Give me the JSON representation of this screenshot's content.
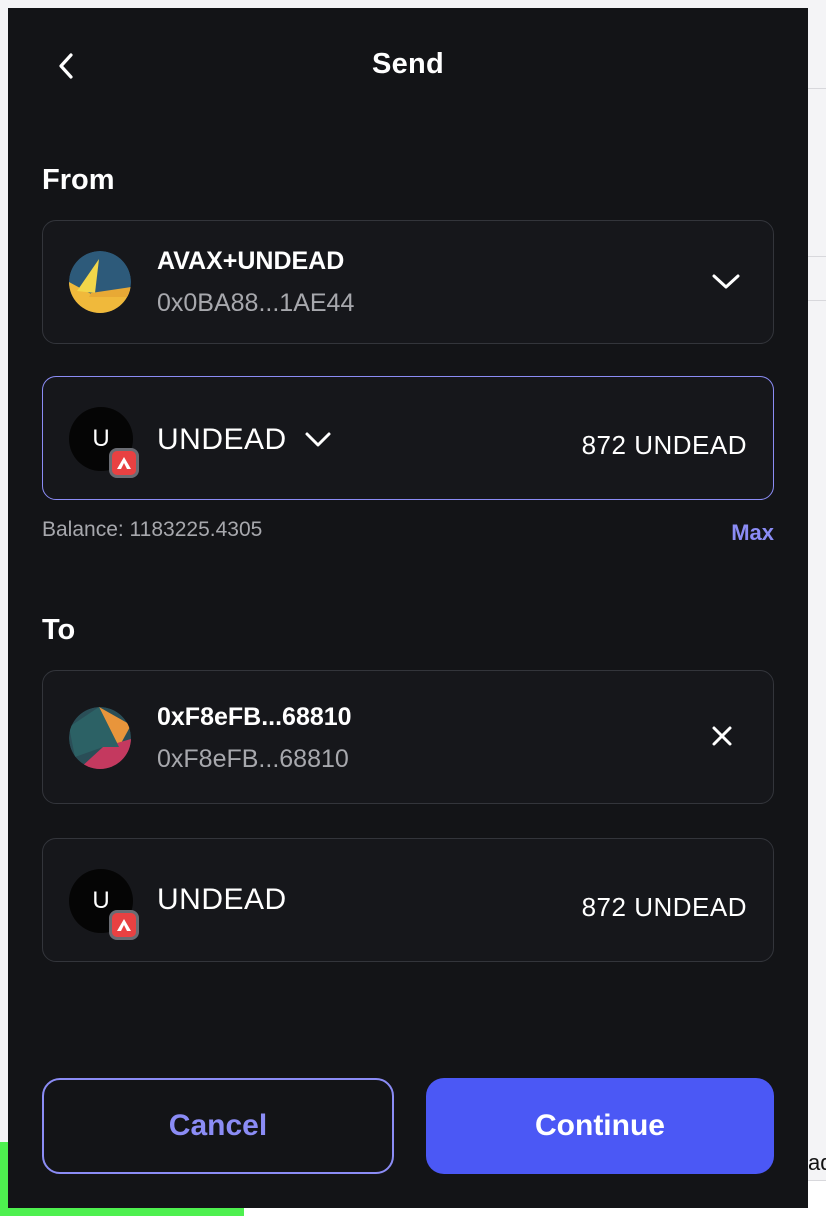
{
  "header": {
    "title": "Send"
  },
  "from": {
    "label": "From",
    "account": {
      "name": "AVAX+UNDEAD",
      "address": "0x0BA88...1AE44"
    },
    "token": {
      "avatar_letter": "U",
      "name": "UNDEAD",
      "amount": "872 UNDEAD"
    },
    "balance": "Balance: 1183225.4305",
    "max_label": "Max"
  },
  "to": {
    "label": "To",
    "recipient": {
      "name": "0xF8eFB...68810",
      "address": "0xF8eFB...68810"
    },
    "token": {
      "avatar_letter": "U",
      "name": "UNDEAD",
      "amount": "872 UNDEAD"
    }
  },
  "actions": {
    "cancel_label": "Cancel",
    "continue_label": "Continue"
  },
  "colors": {
    "accent": "#8b8cf5",
    "primary_button": "#4b58f5",
    "panel": "#131417",
    "avalanche_red": "#e84142"
  },
  "background": {
    "right_text": "ad"
  }
}
